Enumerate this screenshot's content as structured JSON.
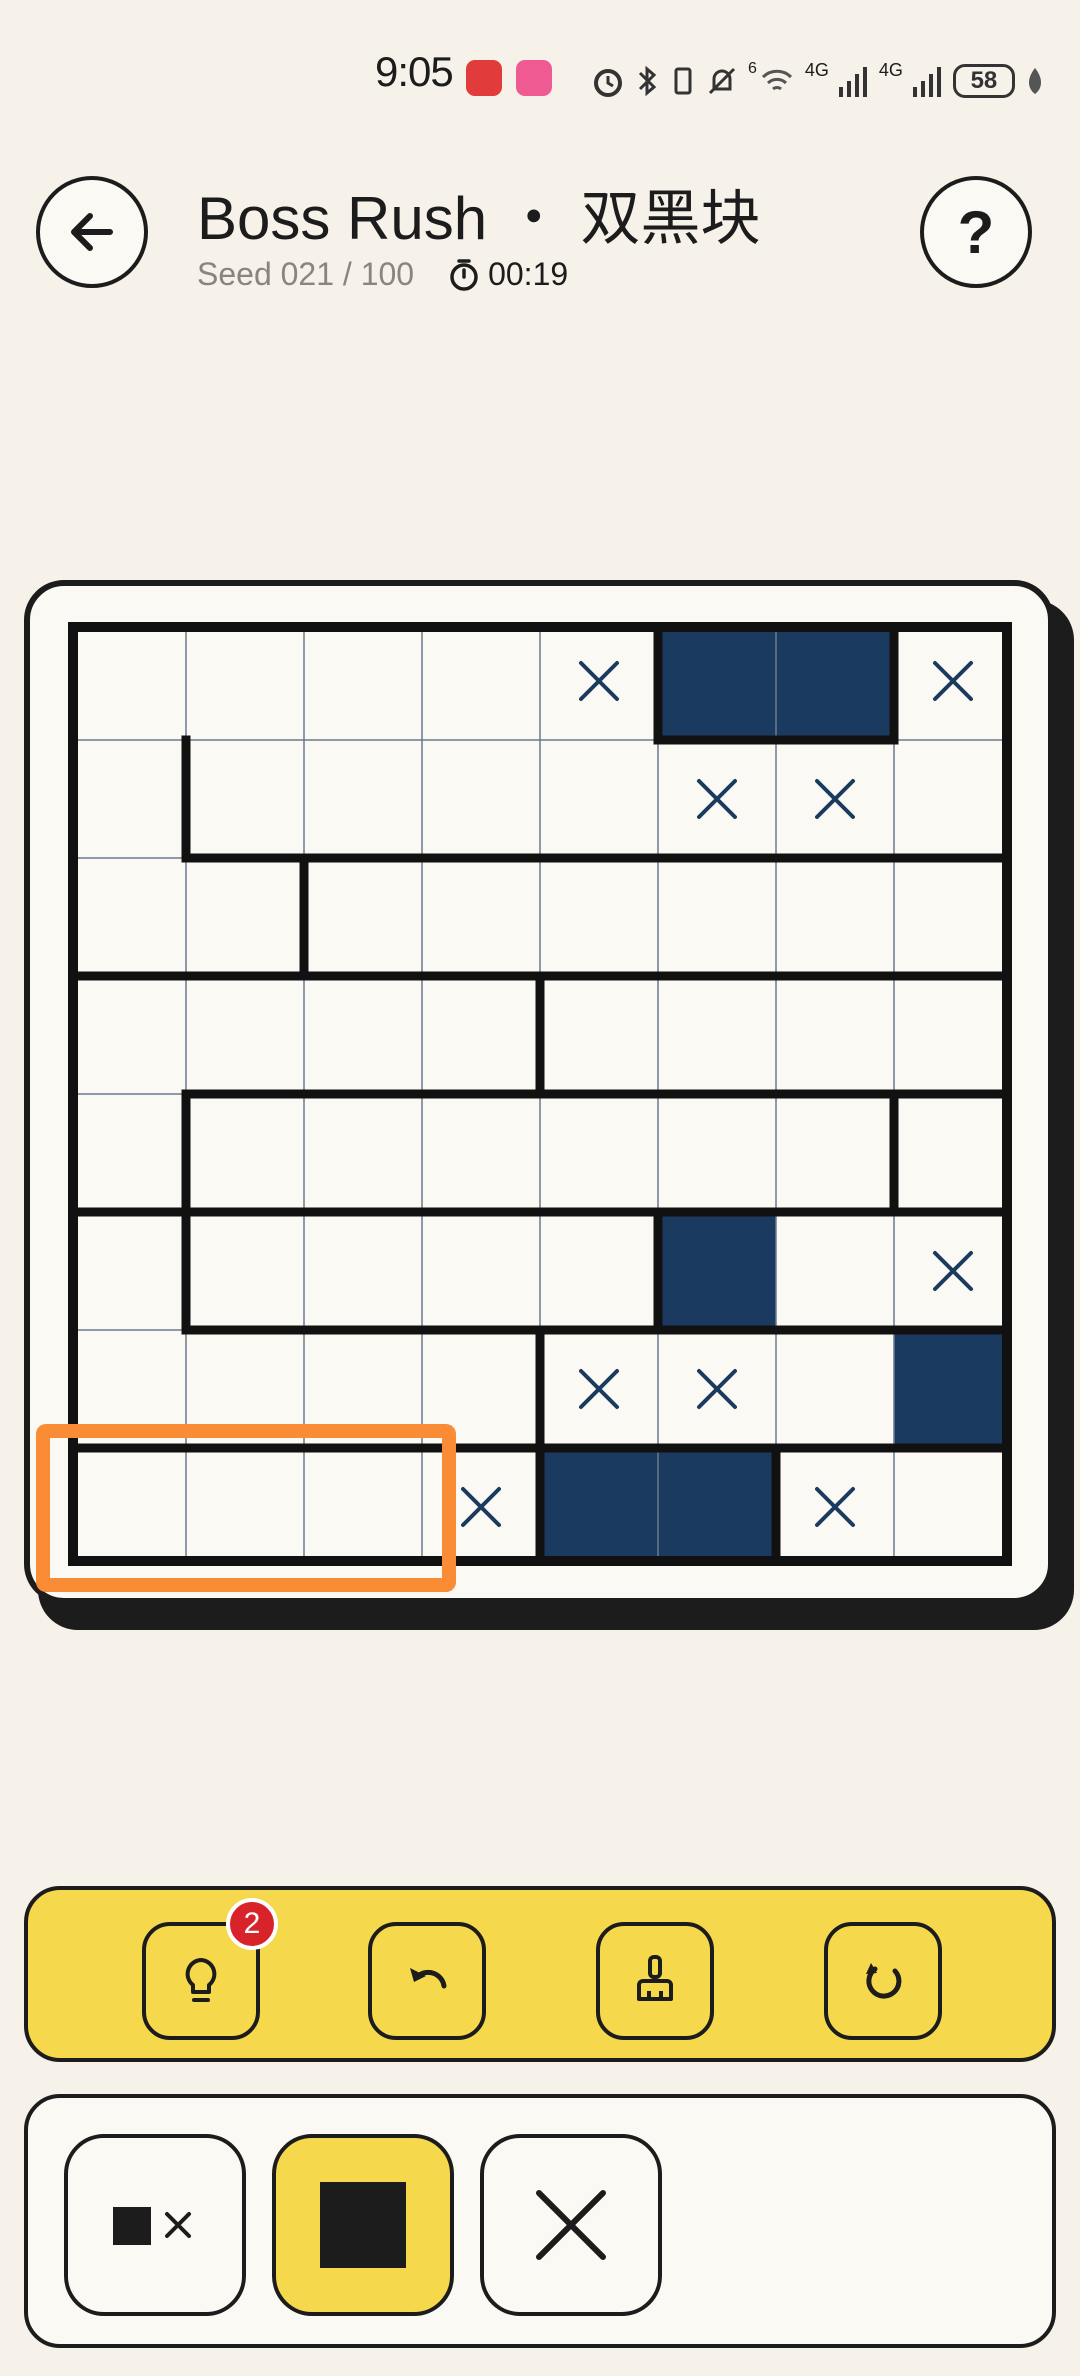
{
  "status_bar": {
    "time": "9:05",
    "network_1": "4G",
    "network_2": "4G",
    "wifi_label": "6",
    "battery": "58"
  },
  "header": {
    "title": "Boss Rush ・ 双黑块",
    "seed": "Seed 021 / 100",
    "timer": "00:19"
  },
  "board": {
    "rows": 8,
    "cols": 8,
    "cells": [
      [
        "",
        "",
        "",
        "",
        "x",
        "black",
        "black",
        "x"
      ],
      [
        "",
        "",
        "",
        "",
        "",
        "x",
        "x",
        ""
      ],
      [
        "",
        "",
        "",
        "",
        "",
        "",
        "",
        ""
      ],
      [
        "",
        "",
        "",
        "",
        "",
        "",
        "",
        ""
      ],
      [
        "",
        "",
        "",
        "",
        "",
        "",
        "",
        ""
      ],
      [
        "",
        "",
        "",
        "",
        "",
        "black",
        "",
        "x"
      ],
      [
        "",
        "",
        "",
        "",
        "x",
        "x",
        "",
        "black"
      ],
      [
        "",
        "",
        "",
        "x",
        "black",
        "black",
        "x",
        ""
      ]
    ],
    "region_borders": {
      "h_after_row": [
        [
          0,
          0,
          0,
          0,
          0,
          1,
          1,
          0
        ],
        [
          0,
          1,
          1,
          1,
          1,
          1,
          1,
          1
        ],
        [
          1,
          1,
          1,
          1,
          1,
          1,
          1,
          1
        ],
        [
          0,
          1,
          1,
          1,
          1,
          1,
          1,
          1
        ],
        [
          1,
          1,
          1,
          1,
          1,
          1,
          1,
          1
        ],
        [
          0,
          1,
          1,
          1,
          1,
          1,
          1,
          1
        ],
        [
          1,
          1,
          1,
          1,
          1,
          1,
          1,
          1
        ]
      ],
      "v_after_col": [
        [
          0,
          0,
          0,
          0,
          1,
          0,
          1,
          0
        ],
        [
          1,
          0,
          0,
          0,
          0,
          0,
          0,
          0
        ],
        [
          0,
          1,
          0,
          0,
          0,
          0,
          0,
          0
        ],
        [
          0,
          0,
          0,
          1,
          0,
          0,
          0,
          0
        ],
        [
          1,
          0,
          0,
          0,
          0,
          0,
          1,
          0
        ],
        [
          1,
          0,
          0,
          0,
          1,
          0,
          0,
          0
        ],
        [
          0,
          0,
          0,
          1,
          0,
          0,
          0,
          1
        ],
        [
          0,
          0,
          0,
          1,
          0,
          1,
          0,
          0
        ]
      ]
    },
    "highlighted_region": "row 8, columns 1–3"
  },
  "toolbar": {
    "hint_icon": "lightbulb-icon",
    "hint_count": "2",
    "undo_icon": "undo-icon",
    "clear_icon": "broom-icon",
    "restart_icon": "restart-icon"
  },
  "modes": [
    {
      "icon": "fill-and-cross-icon",
      "active": false
    },
    {
      "icon": "fill-icon",
      "active": true
    },
    {
      "icon": "cross-icon",
      "active": false
    }
  ],
  "colors": {
    "background": "#f6f2ea",
    "board_bg": "#fbf9f3",
    "black_cell": "#1b3a60",
    "cross": "#1b3a60",
    "toolbar": "#f6d84c",
    "highlight": "#fb8c36",
    "badge": "#d8232a"
  }
}
